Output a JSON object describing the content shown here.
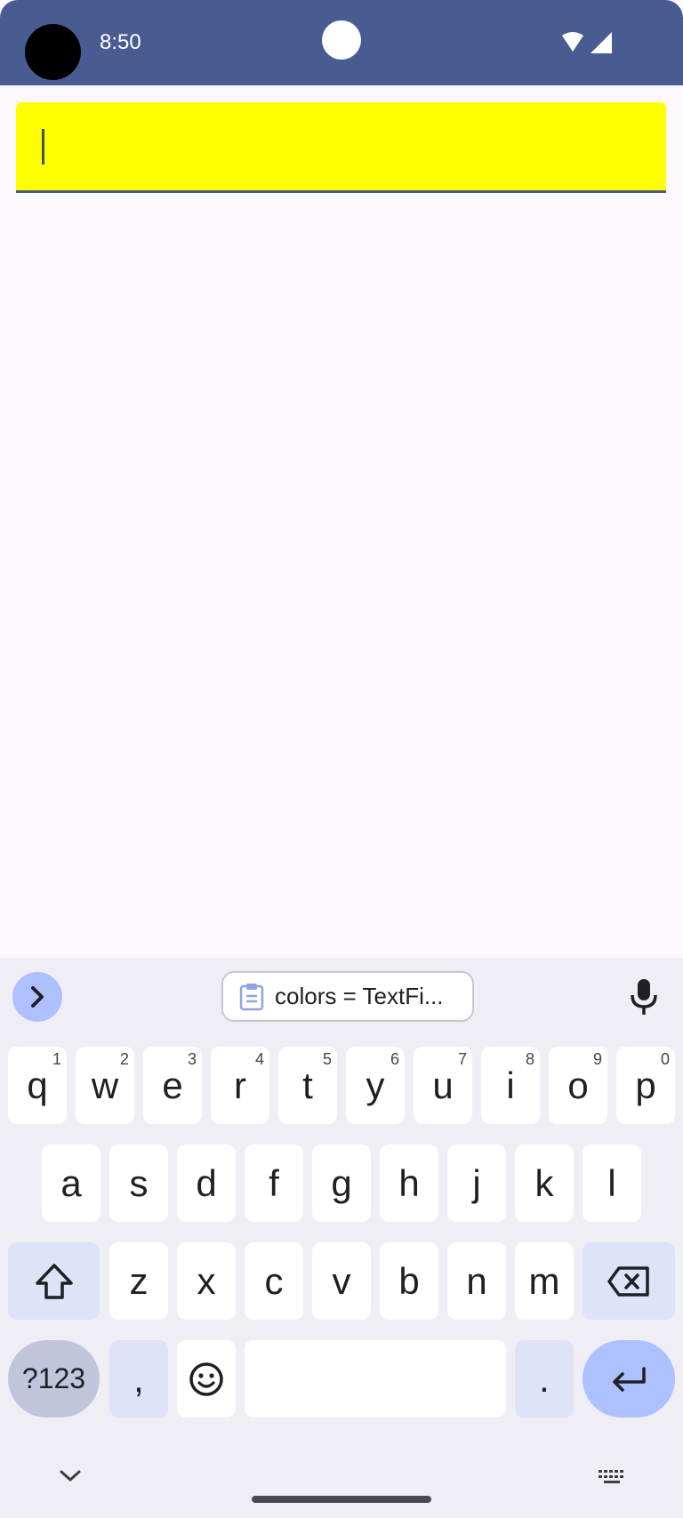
{
  "status_bar": {
    "time": "8:50",
    "bg": "#485c91"
  },
  "text_field": {
    "value": "",
    "bg": "#ffff00"
  },
  "keyboard": {
    "suggestion_chip": "colors = TextFi...",
    "rows": [
      [
        {
          "k": "q",
          "s": "1"
        },
        {
          "k": "w",
          "s": "2"
        },
        {
          "k": "e",
          "s": "3"
        },
        {
          "k": "r",
          "s": "4"
        },
        {
          "k": "t",
          "s": "5"
        },
        {
          "k": "y",
          "s": "6"
        },
        {
          "k": "u",
          "s": "7"
        },
        {
          "k": "i",
          "s": "8"
        },
        {
          "k": "o",
          "s": "9"
        },
        {
          "k": "p",
          "s": "0"
        }
      ],
      [
        {
          "k": "a"
        },
        {
          "k": "s"
        },
        {
          "k": "d"
        },
        {
          "k": "f"
        },
        {
          "k": "g"
        },
        {
          "k": "h"
        },
        {
          "k": "j"
        },
        {
          "k": "k"
        },
        {
          "k": "l"
        }
      ],
      [
        {
          "k": "z"
        },
        {
          "k": "x"
        },
        {
          "k": "c"
        },
        {
          "k": "v"
        },
        {
          "k": "b"
        },
        {
          "k": "n"
        },
        {
          "k": "m"
        }
      ]
    ],
    "symbols_label": "?123",
    "comma_label": ",",
    "period_label": "."
  }
}
